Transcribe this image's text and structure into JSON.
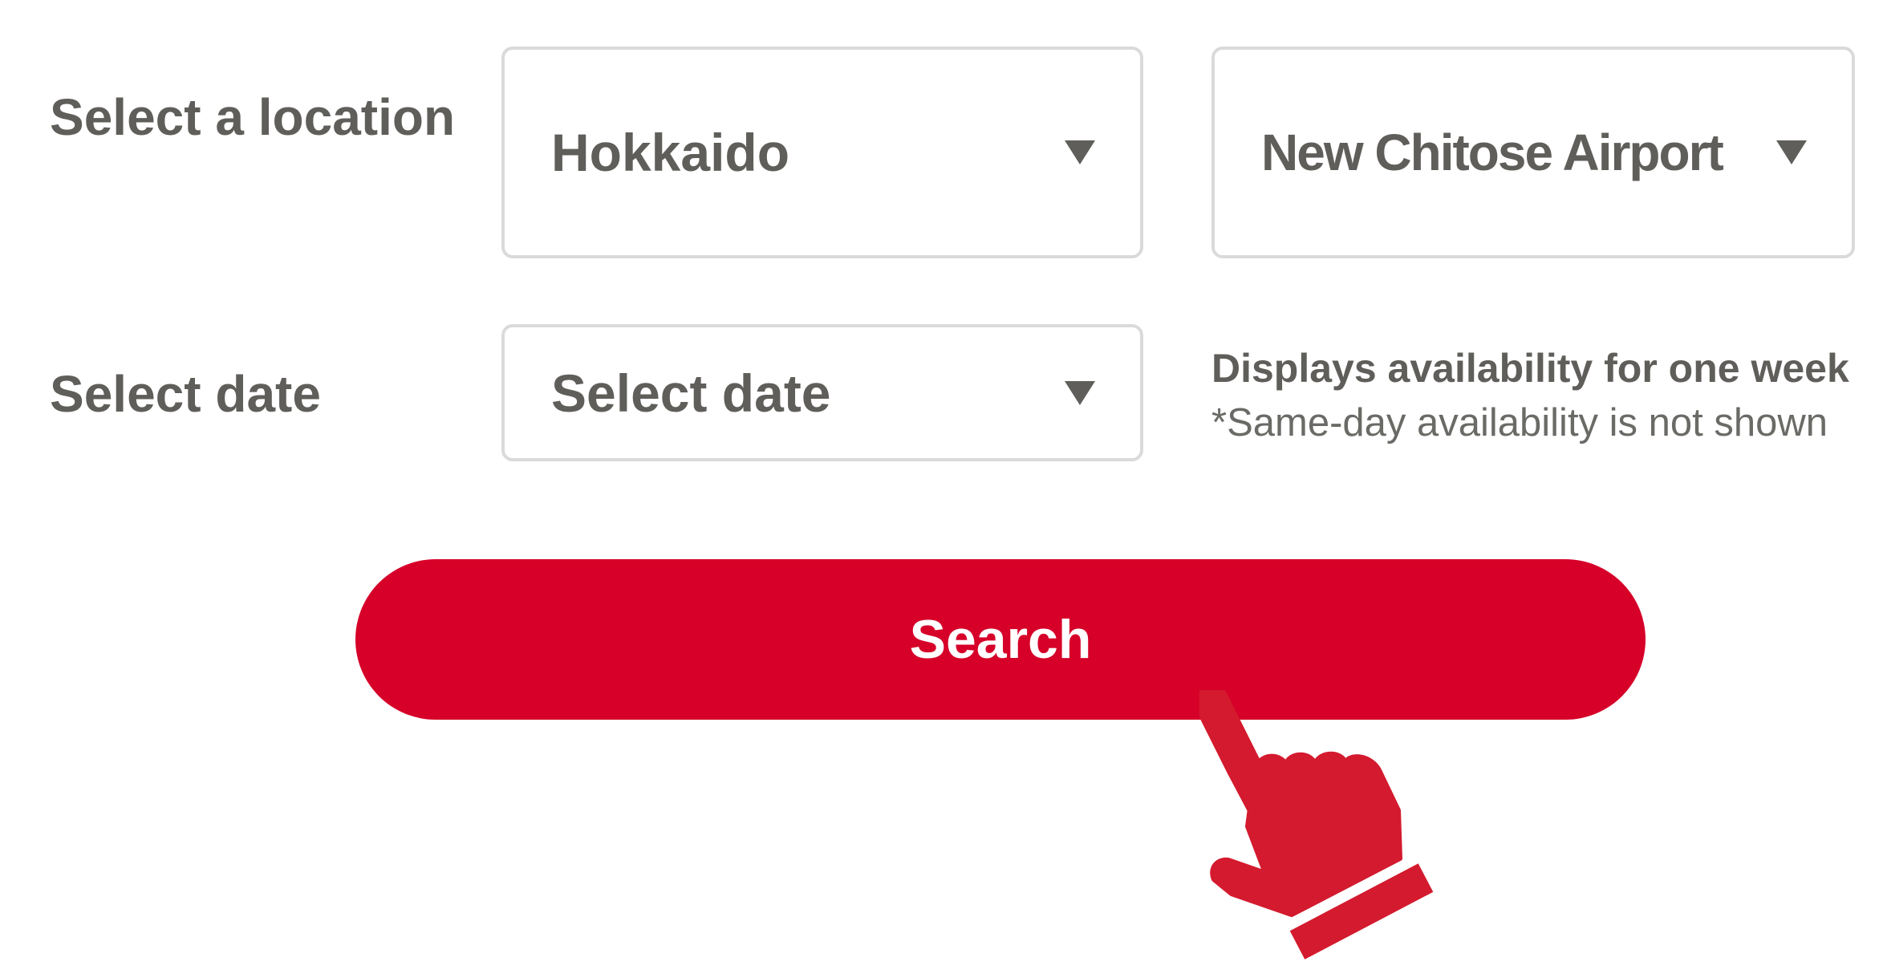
{
  "location": {
    "label": "Select a location",
    "prefecture_select": {
      "value": "Hokkaido"
    },
    "airport_select": {
      "value": "New Chitose Airport"
    }
  },
  "date": {
    "label": "Select date",
    "date_select": {
      "value": "Select date"
    },
    "note_primary": "Displays availability for one week",
    "note_secondary": "*Same-day availability is not shown"
  },
  "search_button": {
    "label": "Search"
  },
  "icons": {
    "dropdown": "chevron-down-icon",
    "pointer": "pointing-hand-icon"
  },
  "colors": {
    "accent": "#d60029",
    "text": "#5f5e5a",
    "border": "#dadada",
    "hand": "#d41a2e"
  }
}
